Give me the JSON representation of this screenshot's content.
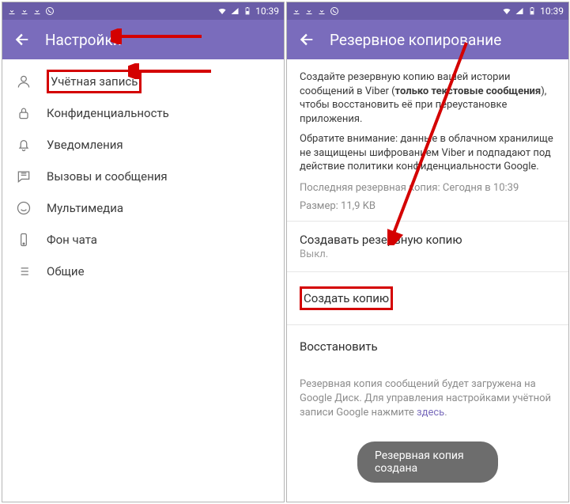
{
  "statusbar": {
    "time": "10:39"
  },
  "left": {
    "title": "Настройки",
    "items": [
      {
        "icon": "user-icon",
        "label": "Учётная запись"
      },
      {
        "icon": "lock-icon",
        "label": "Конфиденциальность"
      },
      {
        "icon": "bell-icon",
        "label": "Уведомления"
      },
      {
        "icon": "chat-icon",
        "label": "Вызовы и сообщения"
      },
      {
        "icon": "smile-icon",
        "label": "Мультимедиа"
      },
      {
        "icon": "phone-icon",
        "label": "Фон чата"
      },
      {
        "icon": "list-icon",
        "label": "Общие"
      }
    ]
  },
  "right": {
    "title": "Резервное копирование",
    "intro1a": "Создайте резервную копию вашей истории сообщений в Viber (",
    "intro1b": "только текстовые сообщения",
    "intro1c": "), чтобы восстановить её при переустановке приложения.",
    "intro2": "Обратите внимание: данные в облачном хранилище не защищены шифрованием Viber и подпадают под действие политики конфиденциальности Google.",
    "last": "Последняя резервная копия: Сегодня в 10:39",
    "size": "Размер: 11,9 KB",
    "freq_title": "Создавать резервную копию",
    "freq_val": "Выкл.",
    "make": "Создать копию",
    "restore": "Восстановить",
    "info": "Резервная копия сообщений будет загружена на Google Диск. Для управления настройками учётной записи Google нажмите ",
    "link": "здесь",
    "snack": "Резервная копия создана"
  }
}
